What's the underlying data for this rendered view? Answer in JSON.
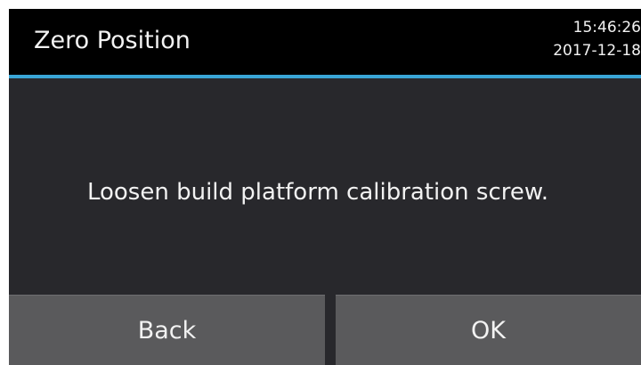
{
  "header": {
    "title": "Zero Position",
    "time": "15:46:26",
    "date": "2017-12-18"
  },
  "main": {
    "message": "Loosen build platform calibration screw."
  },
  "buttons": {
    "back_label": "Back",
    "ok_label": "OK"
  },
  "colors": {
    "background": "#28282c",
    "header": "#000000",
    "accent": "#3aa6d6",
    "button": "#5a5a5c",
    "text": "#f2f2f2"
  }
}
